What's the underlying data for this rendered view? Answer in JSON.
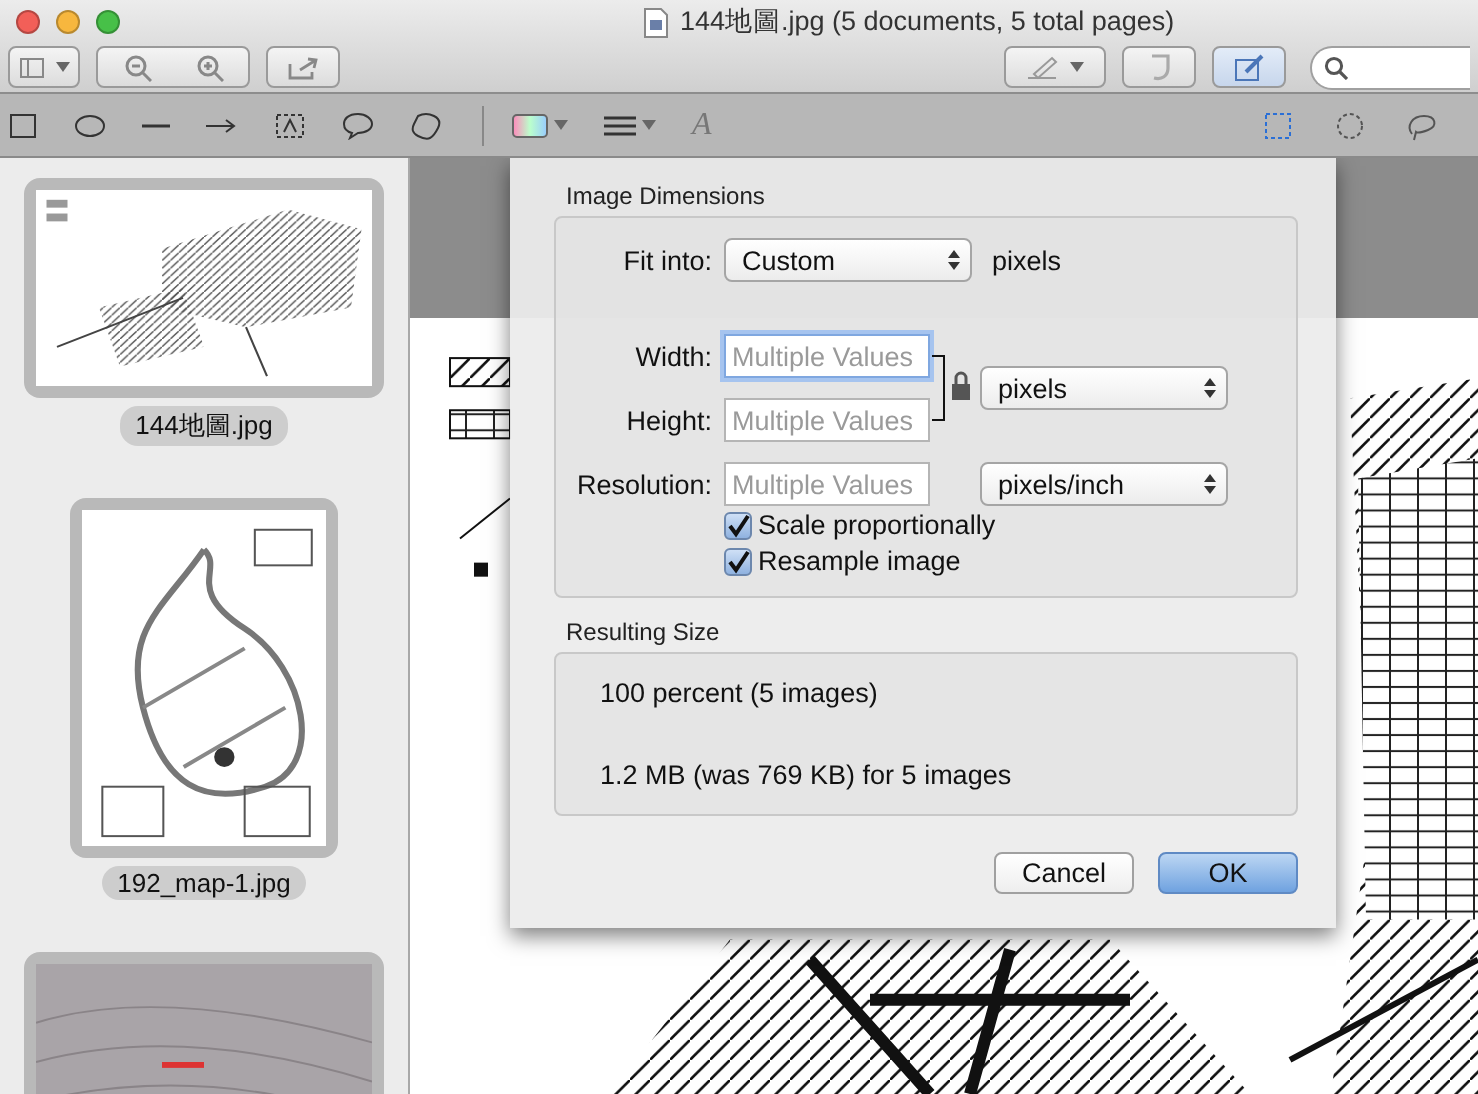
{
  "window": {
    "title": "144地圖.jpg (5 documents, 5 total pages)"
  },
  "annotation_toolbar": {
    "font_button": "A",
    "selection_tools": [
      {
        "kind": "rect",
        "selected": true
      },
      {
        "kind": "ellipse",
        "selected": false
      },
      {
        "kind": "lasso",
        "selected": false
      }
    ]
  },
  "sidebar": {
    "items": [
      {
        "label": "144地圖.jpg",
        "selected": true,
        "kind": "landscape"
      },
      {
        "label": "192_map-1.jpg",
        "selected": true,
        "kind": "portrait"
      },
      {
        "selected": true,
        "kind": "landscape"
      }
    ]
  },
  "dialog": {
    "section_1": "Image Dimensions",
    "fit_into": {
      "label": "Fit into:",
      "value": "Custom",
      "unit": "pixels"
    },
    "fields": [
      {
        "label": "Width:",
        "placeholder": "Multiple Values",
        "focused": true
      },
      {
        "label": "Height:",
        "placeholder": "Multiple Values",
        "focused": false
      },
      {
        "label": "Resolution:",
        "placeholder": "Multiple Values",
        "focused": false
      }
    ],
    "size_unit": "pixels",
    "resolution_unit": "pixels/inch",
    "locked": true,
    "checkboxes": [
      {
        "label": "Scale proportionally",
        "checked": true
      },
      {
        "label": "Resample image",
        "checked": true
      }
    ],
    "section_2": "Resulting Size",
    "results": [
      "100 percent (5 images)",
      "1.2 MB (was 769 KB) for 5 images"
    ],
    "buttons": [
      {
        "label": "Cancel",
        "default": false
      },
      {
        "label": "OK",
        "default": true
      }
    ]
  }
}
